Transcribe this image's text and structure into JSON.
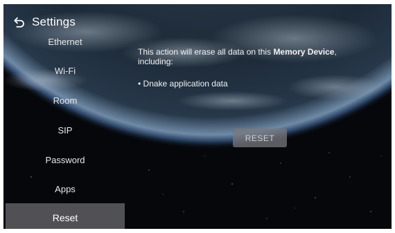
{
  "header": {
    "title": "Settings",
    "back_icon": "back-arrow-icon"
  },
  "sidebar": {
    "items": [
      {
        "label": "Ethernet",
        "active": false
      },
      {
        "label": "Wi-Fi",
        "active": false
      },
      {
        "label": "Room",
        "active": false
      },
      {
        "label": "SIP",
        "active": false
      },
      {
        "label": "Password",
        "active": false
      },
      {
        "label": "Apps",
        "active": false
      },
      {
        "label": "Reset",
        "active": true
      }
    ]
  },
  "main": {
    "message_prefix": "This action will erase all data on this ",
    "message_bold": "Memory Device",
    "message_suffix": ", including:",
    "bullet": "• Dnake application data",
    "reset_label": "RESET"
  },
  "colors": {
    "active_item_bg": "#58585c",
    "reset_button_bg": "#78787d",
    "background": "#05070b"
  }
}
